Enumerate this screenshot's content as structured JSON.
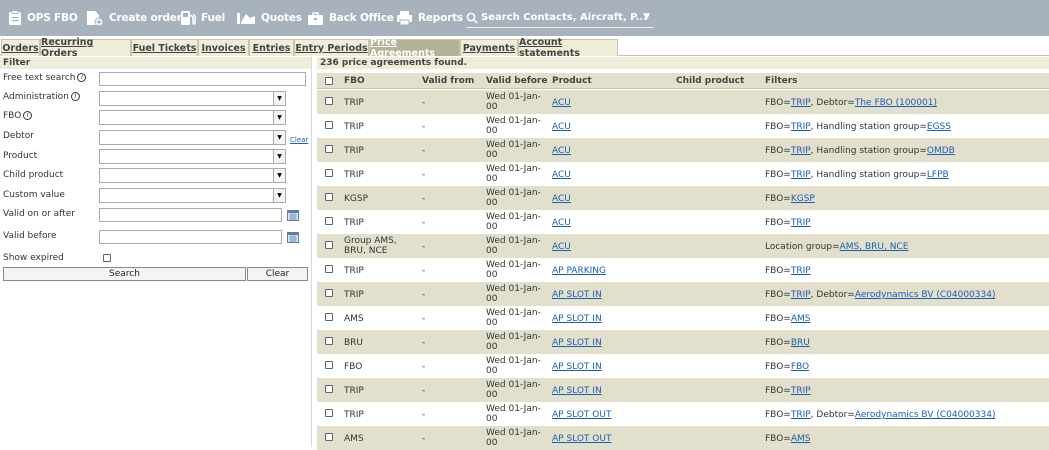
{
  "toolbar": {
    "items": [
      {
        "label": "OPS FBO",
        "icon": "clipboard-icon"
      },
      {
        "label": "Create order",
        "icon": "add-file-icon"
      },
      {
        "label": "Fuel",
        "icon": "fuel-icon"
      },
      {
        "label": "Quotes",
        "icon": "quotes-icon"
      },
      {
        "label": "Back Office",
        "icon": "briefcase-icon"
      },
      {
        "label": "Reports",
        "icon": "printer-icon"
      }
    ],
    "search_placeholder": "Search Contacts, Aircraft, P..."
  },
  "tabs": [
    "Orders",
    "Recurring Orders",
    "Fuel Tickets",
    "Invoices",
    "Entries",
    "Entry Periods",
    "Price Agreements",
    "Payments",
    "Account statements"
  ],
  "active_tab": "Price Agreements",
  "filter": {
    "title": "Filter",
    "fields": {
      "free_text": "Free text search",
      "administration": "Administration",
      "fbo": "FBO",
      "debtor": "Debtor",
      "product": "Product",
      "child_product": "Child product",
      "custom_value": "Custom value",
      "valid_on_or_after": "Valid on or after",
      "valid_before": "Valid before",
      "show_expired": "Show expired"
    },
    "clear_link": "Clear",
    "search_button": "Search",
    "clear_button": "Clear"
  },
  "results": {
    "count_text": "236 price agreements found.",
    "columns": [
      "FBO",
      "Valid from",
      "Valid before",
      "Product",
      "Child product",
      "Filters"
    ],
    "rows": [
      {
        "fbo": "TRIP",
        "valid_from": "-",
        "valid_before": "Wed 01-Jan-00",
        "product": "ACU",
        "child": "",
        "filters": [
          [
            "FBO=",
            ""
          ],
          [
            "TRIP",
            "link"
          ],
          [
            ", Debtor=",
            ""
          ],
          [
            "The FBO (100001)",
            "link"
          ]
        ]
      },
      {
        "fbo": "TRIP",
        "valid_from": "-",
        "valid_before": "Wed 01-Jan-00",
        "product": "ACU",
        "child": "",
        "filters": [
          [
            "FBO=",
            ""
          ],
          [
            "TRIP",
            "link"
          ],
          [
            ", Handling station group=",
            ""
          ],
          [
            "EGSS",
            "link"
          ]
        ]
      },
      {
        "fbo": "TRIP",
        "valid_from": "-",
        "valid_before": "Wed 01-Jan-00",
        "product": "ACU",
        "child": "",
        "filters": [
          [
            "FBO=",
            ""
          ],
          [
            "TRIP",
            "link"
          ],
          [
            ", Handling station group=",
            ""
          ],
          [
            "OMDB",
            "link"
          ]
        ]
      },
      {
        "fbo": "TRIP",
        "valid_from": "-",
        "valid_before": "Wed 01-Jan-00",
        "product": "ACU",
        "child": "",
        "filters": [
          [
            "FBO=",
            ""
          ],
          [
            "TRIP",
            "link"
          ],
          [
            ", Handling station group=",
            ""
          ],
          [
            "LFPB",
            "link"
          ]
        ]
      },
      {
        "fbo": "KGSP",
        "valid_from": "-",
        "valid_before": "Wed 01-Jan-00",
        "product": "ACU",
        "child": "",
        "filters": [
          [
            "FBO=",
            ""
          ],
          [
            "KGSP",
            "link"
          ]
        ]
      },
      {
        "fbo": "TRIP",
        "valid_from": "-",
        "valid_before": "Wed 01-Jan-00",
        "product": "ACU",
        "child": "",
        "filters": [
          [
            "FBO=",
            ""
          ],
          [
            "TRIP",
            "link"
          ]
        ]
      },
      {
        "fbo": "Group AMS, BRU, NCE",
        "valid_from": "-",
        "valid_before": "Wed 01-Jan-00",
        "product": "ACU",
        "child": "",
        "filters": [
          [
            "Location group=",
            ""
          ],
          [
            "AMS, BRU, NCE",
            "link"
          ]
        ]
      },
      {
        "fbo": "TRIP",
        "valid_from": "-",
        "valid_before": "Wed 01-Jan-00",
        "product": "AP PARKING",
        "child": "",
        "filters": [
          [
            "FBO=",
            ""
          ],
          [
            "TRIP",
            "link"
          ]
        ]
      },
      {
        "fbo": "TRIP",
        "valid_from": "-",
        "valid_before": "Wed 01-Jan-00",
        "product": "AP SLOT IN",
        "child": "",
        "filters": [
          [
            "FBO=",
            ""
          ],
          [
            "TRIP",
            "link"
          ],
          [
            ", Debtor=",
            ""
          ],
          [
            "Aerodynamics BV (C04000334)",
            "link"
          ]
        ]
      },
      {
        "fbo": "AMS",
        "valid_from": "-",
        "valid_before": "Wed 01-Jan-00",
        "product": "AP SLOT IN",
        "child": "",
        "filters": [
          [
            "FBO=",
            ""
          ],
          [
            "AMS",
            "link"
          ]
        ]
      },
      {
        "fbo": "BRU",
        "valid_from": "-",
        "valid_before": "Wed 01-Jan-00",
        "product": "AP SLOT IN",
        "child": "",
        "filters": [
          [
            "FBO=",
            ""
          ],
          [
            "BRU",
            "link"
          ]
        ]
      },
      {
        "fbo": "FBO",
        "valid_from": "-",
        "valid_before": "Wed 01-Jan-00",
        "product": "AP SLOT IN",
        "child": "",
        "filters": [
          [
            "FBO=",
            ""
          ],
          [
            "FBO",
            "link"
          ]
        ]
      },
      {
        "fbo": "TRIP",
        "valid_from": "-",
        "valid_before": "Wed 01-Jan-00",
        "product": "AP SLOT IN",
        "child": "",
        "filters": [
          [
            "FBO=",
            ""
          ],
          [
            "TRIP",
            "link"
          ]
        ]
      },
      {
        "fbo": "TRIP",
        "valid_from": "-",
        "valid_before": "Wed 01-Jan-00",
        "product": "AP SLOT OUT",
        "child": "",
        "filters": [
          [
            "FBO=",
            ""
          ],
          [
            "TRIP",
            "link"
          ],
          [
            ", Debtor=",
            ""
          ],
          [
            "Aerodynamics BV (C04000334)",
            "link"
          ]
        ]
      },
      {
        "fbo": "AMS",
        "valid_from": "-",
        "valid_before": "Wed 01-Jan-00",
        "product": "AP SLOT OUT",
        "child": "",
        "filters": [
          [
            "FBO=",
            ""
          ],
          [
            "AMS",
            "link"
          ]
        ]
      }
    ]
  }
}
